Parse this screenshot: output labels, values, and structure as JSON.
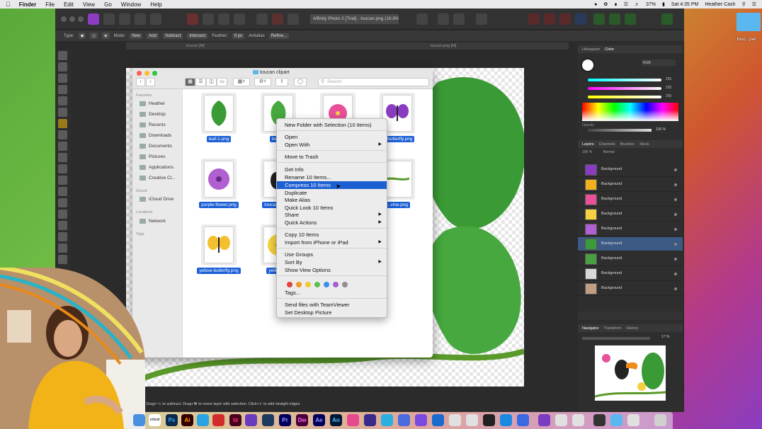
{
  "menubar": {
    "app": "Finder",
    "items": [
      "File",
      "Edit",
      "View",
      "Go",
      "Window",
      "Help"
    ],
    "battery": "37%",
    "clock": "Sat 4:35 PM",
    "user": "Heather Cash"
  },
  "desktop": {
    "folder_label": "touc...par"
  },
  "affinity": {
    "title": "Affinity Photo 2 [Trial] - toucan.png (16.8%)",
    "context": {
      "type_label": "Type:",
      "mode_label": "Mode:",
      "mode_new": "New",
      "mode_add": "Add",
      "mode_subtract": "Subtract",
      "mode_intersect": "Intersect",
      "feather_label": "Feather:",
      "feather_value": "0 px",
      "antialias": "Antialias",
      "refine": "Refine..."
    },
    "tabs": [
      "toucan [M]",
      "toucan.png [M]"
    ],
    "status": "to add. Drag+⌥ to subtract. Drag+⌘ to move layer with selection. Click+⇧ to add straight edges",
    "panels": {
      "top_tabs": [
        "Histogram",
        "Color"
      ],
      "color_model": "RGB",
      "rgb_values": [
        "255",
        "255",
        "255"
      ],
      "opacity_label": "Opacity",
      "opacity_value": "100 %",
      "layer_tabs": [
        "Layers",
        "Channels",
        "Brushes",
        "Stock"
      ],
      "layer_opacity": "100 %",
      "blend_mode": "Normal",
      "layers": [
        {
          "name": "Background",
          "color": "#8a3cc0"
        },
        {
          "name": "Background",
          "color": "#f0b020"
        },
        {
          "name": "Background",
          "color": "#e8509a"
        },
        {
          "name": "Background",
          "color": "#f5d040"
        },
        {
          "name": "Background",
          "color": "#b060d0"
        },
        {
          "name": "Background",
          "color": "#3d9a3a",
          "selected": true
        },
        {
          "name": "Background",
          "color": "#48a040"
        },
        {
          "name": "Background",
          "color": "#d8d8d8"
        },
        {
          "name": "Background",
          "color": "#c0a080"
        }
      ],
      "nav_tabs": [
        "Navigator",
        "Transform",
        "History"
      ],
      "zoom": "17 %"
    }
  },
  "finder": {
    "title": "toucan clipart",
    "search_placeholder": "Search",
    "sidebar": {
      "favorites_heading": "Favorites",
      "favorites": [
        "Heather",
        "Desktop",
        "Recents",
        "Downloads",
        "Documents",
        "Pictures",
        "Applications",
        "Creative Cl..."
      ],
      "icloud_heading": "iCloud",
      "icloud": [
        "iCloud Drive"
      ],
      "locations_heading": "Locations",
      "locations": [
        "Network"
      ],
      "tags_heading": "Tags"
    },
    "files": [
      {
        "label": "leaf-1.png"
      },
      {
        "label": "leaf-..."
      },
      {
        "label": ""
      },
      {
        "label": "...-butterfly.png"
      },
      {
        "label": "purple-flower.png"
      },
      {
        "label": "touca... bab..."
      },
      {
        "label": "...vine.png"
      },
      {
        "label": "yellow-butterfly.png"
      },
      {
        "label": "yellow-f..."
      }
    ]
  },
  "context_menu": {
    "new_folder": "New Folder with Selection (10 Items)",
    "open": "Open",
    "open_with": "Open With",
    "move_to_trash": "Move to Trash",
    "get_info": "Get Info",
    "rename": "Rename 10 Items...",
    "compress": "Compress 10 Items",
    "duplicate": "Duplicate",
    "make_alias": "Make Alias",
    "quick_look": "Quick Look 10 Items",
    "share": "Share",
    "quick_actions": "Quick Actions",
    "copy": "Copy 10 Items",
    "import": "Import from iPhone or iPad",
    "use_groups": "Use Groups",
    "sort_by": "Sort By",
    "show_view_options": "Show View Options",
    "tag_colors": [
      "#e0443e",
      "#f39a2b",
      "#f1c933",
      "#5ac04f",
      "#3d8ef0",
      "#a65dd3",
      "#8e8e93"
    ],
    "tags": "Tags...",
    "teamviewer": "Send files with TeamViewer",
    "desktop_picture": "Set Desktop Picture"
  },
  "dock": {
    "apps": [
      "Ps",
      "Ai",
      "Id",
      "Pr",
      "Dw",
      "Ae",
      "An"
    ]
  }
}
